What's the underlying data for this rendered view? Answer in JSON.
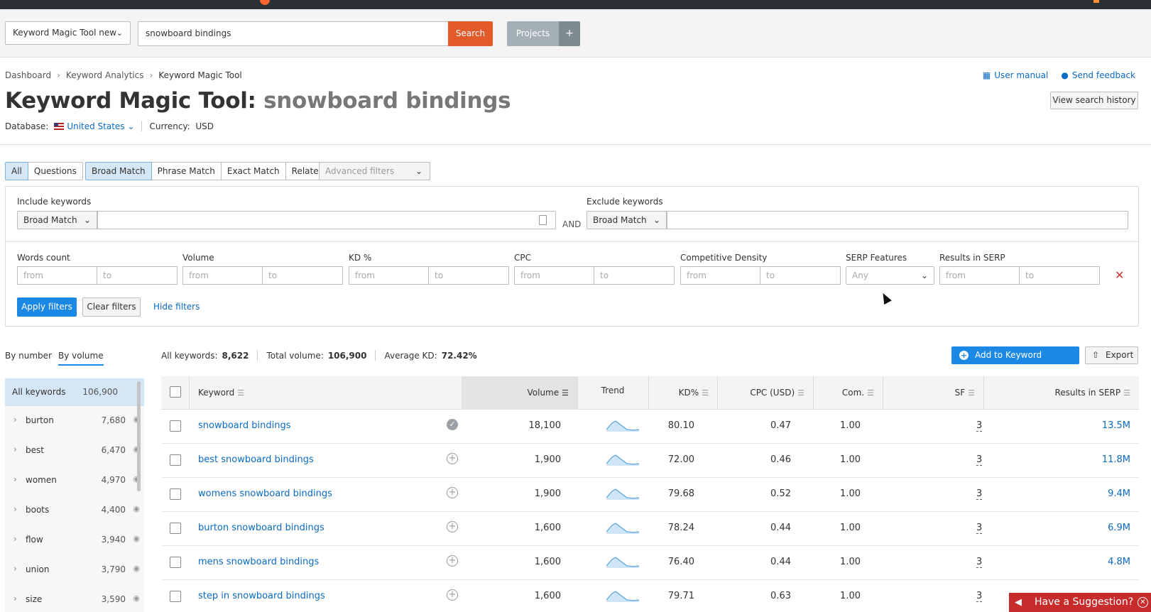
{
  "header": {
    "tool_select": "Keyword Magic Tool new",
    "query": "snowboard bindings",
    "search_label": "Search",
    "projects_label": "Projects",
    "plus_label": "+"
  },
  "breadcrumb": [
    "Dashboard",
    "Keyword Analytics",
    "Keyword Magic Tool"
  ],
  "links": {
    "user_manual": "User manual",
    "feedback": "Send feedback"
  },
  "title": {
    "prefix": "Keyword Magic Tool:",
    "query": "snowboard bindings"
  },
  "view_history": "View search history",
  "database": {
    "label": "Database:",
    "value": "United States",
    "currency_label": "Currency:",
    "currency": "USD"
  },
  "tabs": [
    "All",
    "Questions"
  ],
  "match_tabs": [
    "Broad Match",
    "Phrase Match",
    "Exact Match",
    "Related"
  ],
  "advanced_filters": "Advanced filters",
  "filters": {
    "include_label": "Include keywords",
    "exclude_label": "Exclude keywords",
    "include_match": "Broad Match",
    "exclude_match": "Broad Match",
    "and_label": "AND",
    "ranges": [
      {
        "label": "Words count",
        "from": "from",
        "to": "to"
      },
      {
        "label": "Volume",
        "from": "from",
        "to": "to"
      },
      {
        "label": "KD %",
        "from": "from",
        "to": "to"
      },
      {
        "label": "CPC",
        "from": "from",
        "to": "to"
      },
      {
        "label": "Competitive Density",
        "from": "from",
        "to": "to"
      }
    ],
    "serp_label": "SERP Features",
    "serp_value": "Any",
    "results_label": "Results in SERP",
    "results_from": "from",
    "results_to": "to",
    "apply": "Apply filters",
    "clear": "Clear filters",
    "hide": "Hide filters"
  },
  "group_toggle": {
    "by_number": "By number",
    "by_volume": "By volume"
  },
  "stats": {
    "all_label": "All keywords:",
    "all_value": "8,622",
    "volume_label": "Total volume:",
    "volume_value": "106,900",
    "kd_label": "Average KD:",
    "kd_value": "72.42%"
  },
  "actions": {
    "add_manager": "Add to Keyword Manager",
    "export": "Export"
  },
  "sidebar": {
    "head": {
      "name": "All keywords",
      "count": "106,900"
    },
    "items": [
      {
        "name": "burton",
        "count": "7,680"
      },
      {
        "name": "best",
        "count": "6,470"
      },
      {
        "name": "women",
        "count": "4,970"
      },
      {
        "name": "boots",
        "count": "4,400"
      },
      {
        "name": "flow",
        "count": "3,940"
      },
      {
        "name": "union",
        "count": "3,790"
      },
      {
        "name": "size",
        "count": "3,590"
      }
    ]
  },
  "table": {
    "columns": {
      "keyword": "Keyword",
      "volume": "Volume",
      "trend": "Trend",
      "kd": "KD%",
      "cpc": "CPC (USD)",
      "com": "Com.",
      "sf": "SF",
      "serp": "Results in SERP"
    },
    "rows": [
      {
        "keyword": "snowboard bindings",
        "volume": "18,100",
        "kd": "80.10",
        "cpc": "0.47",
        "com": "1.00",
        "sf": "3",
        "serp": "13.5M",
        "added": true
      },
      {
        "keyword": "best snowboard bindings",
        "volume": "1,900",
        "kd": "72.00",
        "cpc": "0.46",
        "com": "1.00",
        "sf": "3",
        "serp": "11.8M",
        "added": false
      },
      {
        "keyword": "womens snowboard bindings",
        "volume": "1,900",
        "kd": "79.68",
        "cpc": "0.52",
        "com": "1.00",
        "sf": "3",
        "serp": "9.4M",
        "added": false
      },
      {
        "keyword": "burton snowboard bindings",
        "volume": "1,600",
        "kd": "78.24",
        "cpc": "0.44",
        "com": "1.00",
        "sf": "3",
        "serp": "6.9M",
        "added": false
      },
      {
        "keyword": "mens snowboard bindings",
        "volume": "1,600",
        "kd": "76.40",
        "cpc": "0.44",
        "com": "1.00",
        "sf": "3",
        "serp": "4.8M",
        "added": false
      },
      {
        "keyword": "step in snowboard bindings",
        "volume": "1,600",
        "kd": "79.71",
        "cpc": "0.63",
        "com": "1.00",
        "sf": "3",
        "serp": "",
        "added": false
      }
    ]
  },
  "suggestion": "Have a Suggestion?",
  "colors": {
    "accent": "#1c88e5",
    "search": "#e2592a",
    "link": "#0a6bc2",
    "suggest": "#c82b2b"
  }
}
